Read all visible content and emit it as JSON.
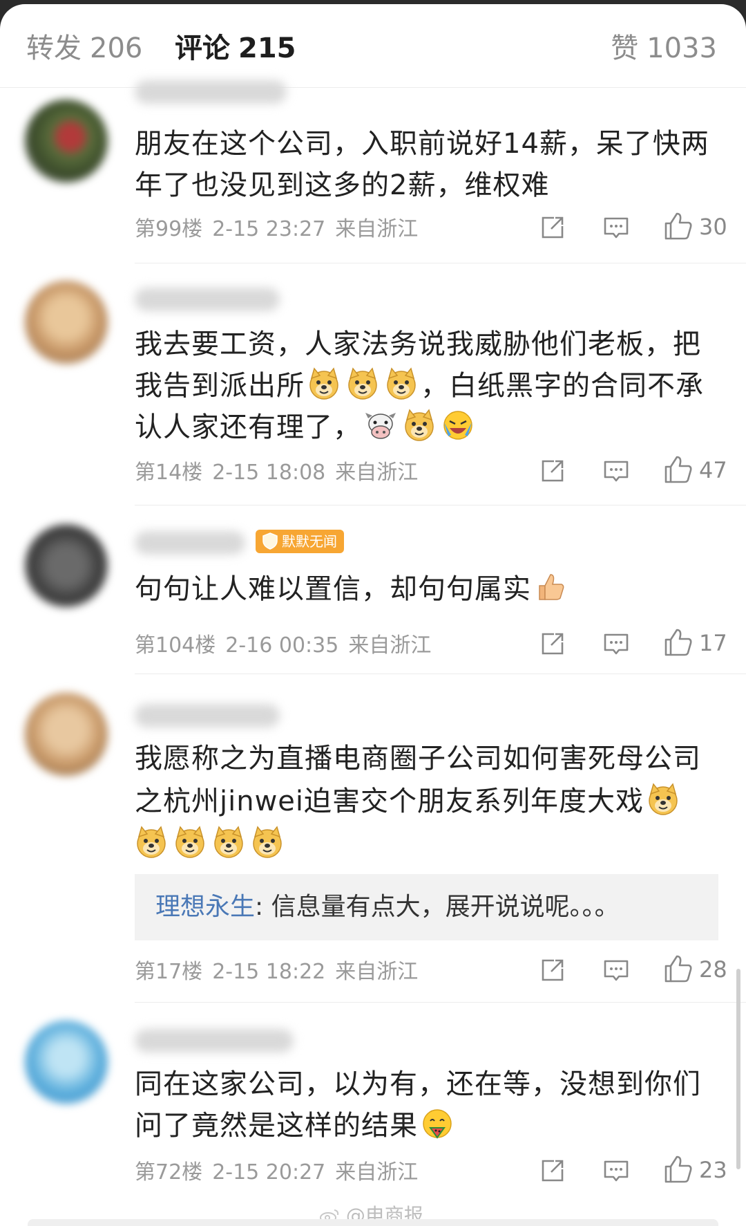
{
  "header": {
    "reposts_label": "转发",
    "reposts_count": "206",
    "comments_label": "评论",
    "comments_count": "215",
    "likes_label": "赞",
    "likes_count": "1033"
  },
  "comments": [
    {
      "text": "朋友在这个公司，入职前说好14薪，呆了快两年了也没见到这多的2薪，维权难",
      "floor": "第99楼",
      "time": "2-15 23:27",
      "location": "来自浙江",
      "likes": "30"
    },
    {
      "text_parts": [
        "我去要工资，人家法务说我威胁他们老板，把我告到派出所",
        "，白纸黑字的合同不承认人家还有理了，"
      ],
      "floor": "第14楼",
      "time": "2-15 18:08",
      "location": "来自浙江",
      "likes": "47"
    },
    {
      "badge": "默默无闻",
      "text": "句句让人难以置信，却句句属实",
      "floor": "第104楼",
      "time": "2-16 00:35",
      "location": "来自浙江",
      "likes": "17"
    },
    {
      "text": "我愿称之为直播电商圈子公司如何害死母公司之杭州jinwei迫害交个朋友系列年度大戏",
      "reply_name": "理想永生",
      "reply_text": ": 信息量有点大，展开说说呢。。。",
      "floor": "第17楼",
      "time": "2-15 18:22",
      "location": "来自浙江",
      "likes": "28"
    },
    {
      "text": "同在这家公司，以为有，还在等，没想到你们问了竟然是这样的结果",
      "floor": "第72楼",
      "time": "2-15 20:27",
      "location": "来自浙江",
      "likes": "23"
    }
  ],
  "watermark": "@电商报",
  "icons": {
    "share": "share-icon",
    "comment": "comment-icon",
    "like": "thumbs-up-icon",
    "doge": "doge-emoji-icon",
    "cow": "cow-emoji-icon",
    "laugh": "laugh-cry-emoji-icon",
    "thumb": "thumbs-up-emoji-icon",
    "weibo": "weibo-logo-icon"
  },
  "colors": {
    "reply_name": "#4a78b6",
    "badge": "#f7a633",
    "meta": "#9a9a9a"
  }
}
